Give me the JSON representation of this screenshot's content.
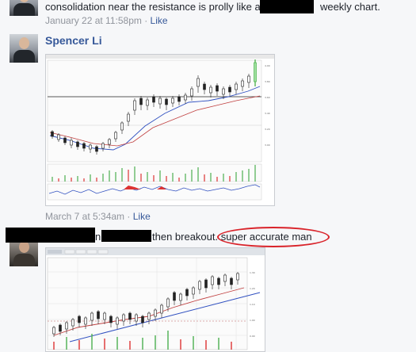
{
  "comments": [
    {
      "text_before": "consolidation near the resistance is prolly like a",
      "text_after": "weekly chart.",
      "timestamp": "January 22 at 11:58pm",
      "separator": "·",
      "like_label": "Like"
    },
    {
      "author": "Spencer Li",
      "timestamp": "March 7 at 5:34am",
      "separator": "·",
      "like_label": "Like",
      "image": "stock-chart-screenshot"
    },
    {
      "text_mid1": "n",
      "text_mid2": "then breakout.",
      "text_highlight": "super accurate man",
      "highlight_color": "#d9232a",
      "image": "stock-chart-screenshot"
    }
  ],
  "colors": {
    "link": "#365899",
    "meta": "#90949c",
    "text": "#1d2129",
    "background": "#f6f7f9",
    "redaction": "#000000",
    "candle_up": "#ffffff",
    "candle_down": "#222222",
    "volume_up": "#4caf50",
    "volume_down": "#d33",
    "ma_line": "#c04040",
    "trend_line": "#3050c0"
  },
  "icons": [
    "profile-photo",
    "profile-photo",
    "profile-photo"
  ]
}
